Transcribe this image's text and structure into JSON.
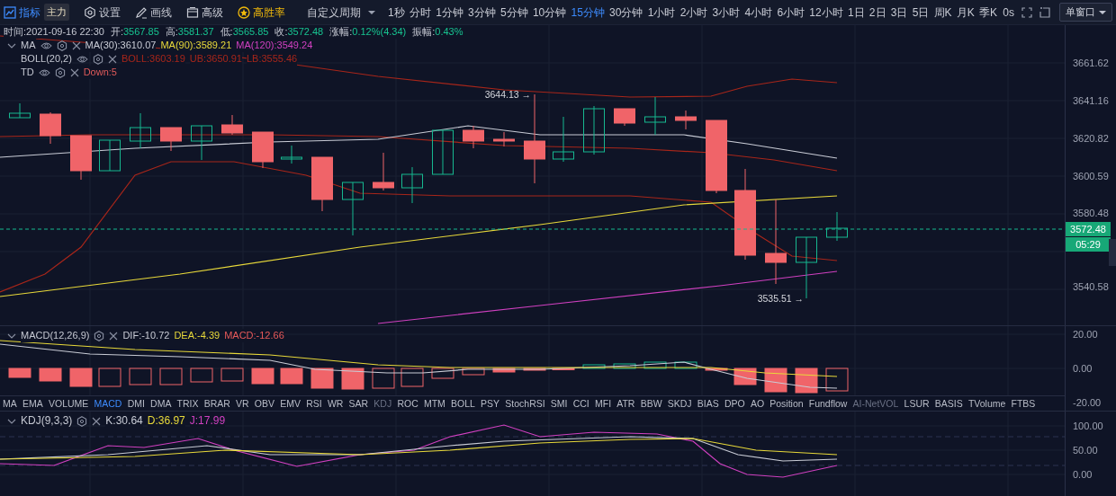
{
  "toolbar": {
    "indicator": {
      "label": "指标",
      "selected": true
    },
    "main_badge": "主力",
    "tools": [
      {
        "label": "设置",
        "kind": "settings"
      },
      {
        "label": "画线",
        "kind": "draw"
      },
      {
        "label": "高级",
        "kind": "advanced"
      },
      {
        "label": "高胜率",
        "kind": "win-rate"
      }
    ],
    "custom_period": "自定义周期",
    "intervals": [
      {
        "label": "1秒",
        "selected": false
      },
      {
        "label": "分时",
        "selected": false
      },
      {
        "label": "1分钟",
        "selected": false
      },
      {
        "label": "3分钟",
        "selected": false
      },
      {
        "label": "5分钟",
        "selected": false
      },
      {
        "label": "10分钟",
        "selected": false
      },
      {
        "label": "15分钟",
        "selected": true
      },
      {
        "label": "30分钟",
        "selected": false
      },
      {
        "label": "1小时",
        "selected": false
      },
      {
        "label": "2小时",
        "selected": false
      },
      {
        "label": "3小时",
        "selected": false
      },
      {
        "label": "4小时",
        "selected": false
      },
      {
        "label": "6小时",
        "selected": false
      },
      {
        "label": "12小时",
        "selected": false
      },
      {
        "label": "1日",
        "selected": false
      },
      {
        "label": "2日",
        "selected": false
      },
      {
        "label": "3日",
        "selected": false
      },
      {
        "label": "5日",
        "selected": false
      },
      {
        "label": "周K",
        "selected": false
      },
      {
        "label": "月K",
        "selected": false
      },
      {
        "label": "季K",
        "selected": false
      }
    ],
    "refresh": "0s",
    "window_mode": "单窗口"
  },
  "info_bar": [
    {
      "label": "时间:",
      "value": "2021-09-16 22:30",
      "kind": "plain"
    },
    {
      "label": "开:",
      "value": "3567.85",
      "kind": "up"
    },
    {
      "label": "高:",
      "value": "3581.37",
      "kind": "up"
    },
    {
      "label": "低:",
      "value": "3565.85",
      "kind": "up"
    },
    {
      "label": "收:",
      "value": "3572.48",
      "kind": "up"
    },
    {
      "label": "涨幅:",
      "value": "0.12%(4.34)",
      "kind": "up"
    },
    {
      "label": "振幅:",
      "value": "0.43%",
      "kind": "up"
    }
  ],
  "legends": [
    {
      "name": "MA",
      "collapsible": true,
      "values": [
        {
          "text": "MA(30):3610.07",
          "color": "#c9ccd6"
        },
        {
          "text": "MA(90):3589.21",
          "color": "#e8d93a"
        },
        {
          "text": "MA(120):3549.24",
          "color": "#d040c0"
        }
      ]
    },
    {
      "name": "BOLL(20,2)",
      "collapsible": false,
      "values": [
        {
          "text": "BOLL:3603.19",
          "color": "#a8261a"
        },
        {
          "text": "UB:3650.91",
          "color": "#a8261a"
        },
        {
          "text": "LB:3555.46",
          "color": "#a8261a"
        }
      ]
    },
    {
      "name": "TD",
      "collapsible": false,
      "values": [
        {
          "text": "Down:5",
          "color": "#e05a5a"
        }
      ]
    }
  ],
  "price_axis": {
    "labels": [
      "3661.62",
      "3641.16",
      "3620.82",
      "3600.59",
      "3580.48",
      "3540.58"
    ],
    "last_price": "3572.48",
    "countdown": "05:29"
  },
  "annotations": [
    {
      "text": "3644.13 →",
      "kind": "high"
    },
    {
      "text": "3535.51 →",
      "kind": "low"
    }
  ],
  "macd": {
    "title": "MACD(12,26,9)",
    "values": [
      {
        "text": "DIF:-10.72",
        "color": "#c9ccd6"
      },
      {
        "text": "DEA:-4.39",
        "color": "#e8d93a"
      },
      {
        "text": "MACD:-12.66",
        "color": "#e85a5a"
      }
    ],
    "axis": [
      "20.00",
      "0.00",
      "-20.00"
    ]
  },
  "indicator_tabs": [
    {
      "label": "MA",
      "selected": false,
      "disabled": false
    },
    {
      "label": "EMA",
      "selected": false,
      "disabled": false
    },
    {
      "label": "VOLUME",
      "selected": false,
      "disabled": false
    },
    {
      "label": "MACD",
      "selected": true,
      "disabled": false
    },
    {
      "label": "DMI",
      "selected": false,
      "disabled": false
    },
    {
      "label": "DMA",
      "selected": false,
      "disabled": false
    },
    {
      "label": "TRIX",
      "selected": false,
      "disabled": false
    },
    {
      "label": "BRAR",
      "selected": false,
      "disabled": false
    },
    {
      "label": "VR",
      "selected": false,
      "disabled": false
    },
    {
      "label": "OBV",
      "selected": false,
      "disabled": false
    },
    {
      "label": "EMV",
      "selected": false,
      "disabled": false
    },
    {
      "label": "RSI",
      "selected": false,
      "disabled": false
    },
    {
      "label": "WR",
      "selected": false,
      "disabled": false
    },
    {
      "label": "SAR",
      "selected": false,
      "disabled": false
    },
    {
      "label": "KDJ",
      "selected": false,
      "disabled": true
    },
    {
      "label": "ROC",
      "selected": false,
      "disabled": false
    },
    {
      "label": "MTM",
      "selected": false,
      "disabled": false
    },
    {
      "label": "BOLL",
      "selected": false,
      "disabled": false
    },
    {
      "label": "PSY",
      "selected": false,
      "disabled": false
    },
    {
      "label": "StochRSI",
      "selected": false,
      "disabled": false
    },
    {
      "label": "SMI",
      "selected": false,
      "disabled": false
    },
    {
      "label": "CCI",
      "selected": false,
      "disabled": false
    },
    {
      "label": "MFI",
      "selected": false,
      "disabled": false
    },
    {
      "label": "ATR",
      "selected": false,
      "disabled": false
    },
    {
      "label": "BBW",
      "selected": false,
      "disabled": false
    },
    {
      "label": "SKDJ",
      "selected": false,
      "disabled": false
    },
    {
      "label": "BIAS",
      "selected": false,
      "disabled": false
    },
    {
      "label": "DPO",
      "selected": false,
      "disabled": false
    },
    {
      "label": "AO",
      "selected": false,
      "disabled": false
    },
    {
      "label": "Position",
      "selected": false,
      "disabled": false
    },
    {
      "label": "Fundflow",
      "selected": false,
      "disabled": false
    },
    {
      "label": "AI-NetVOL",
      "selected": false,
      "disabled": true
    },
    {
      "label": "LSUR",
      "selected": false,
      "disabled": false
    },
    {
      "label": "BASIS",
      "selected": false,
      "disabled": false
    },
    {
      "label": "TVolume",
      "selected": false,
      "disabled": false
    },
    {
      "label": "FTBS",
      "selected": false,
      "disabled": false
    }
  ],
  "kdj": {
    "title": "KDJ(9,3,3)",
    "values": [
      {
        "text": "K:30.64",
        "color": "#c9ccd6"
      },
      {
        "text": "D:36.97",
        "color": "#e8d93a"
      },
      {
        "text": "J:17.99",
        "color": "#d040c0"
      }
    ],
    "axis": [
      "100.00",
      "50.00",
      "0.00"
    ]
  }
}
